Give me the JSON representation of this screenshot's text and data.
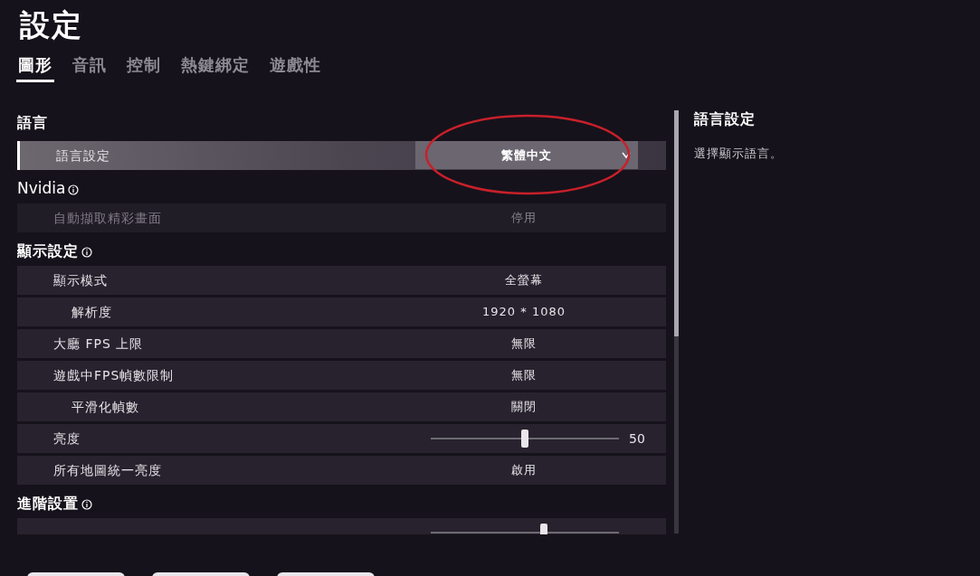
{
  "title": "設定",
  "tabs": [
    {
      "label": "圖形",
      "selected": true
    },
    {
      "label": "音訊",
      "selected": false
    },
    {
      "label": "控制",
      "selected": false
    },
    {
      "label": "熱鍵綁定",
      "selected": false
    },
    {
      "label": "遊戲性",
      "selected": false
    }
  ],
  "sections": [
    {
      "title": "語言",
      "info": false,
      "rows": [
        {
          "kind": "dropdown",
          "label": "語言設定",
          "value": "繁體中文",
          "selected": true,
          "disabled": false
        }
      ]
    },
    {
      "title": "Nvidia",
      "info": true,
      "rows": [
        {
          "kind": "value",
          "label": "自動擷取精彩畫面",
          "value": "停用",
          "selected": false,
          "disabled": true
        }
      ]
    },
    {
      "title": "顯示設定",
      "info": true,
      "rows": [
        {
          "kind": "value",
          "label": "顯示模式",
          "value": "全螢幕",
          "selected": false,
          "disabled": false,
          "children": [
            {
              "kind": "value",
              "label": "解析度",
              "value": "1920 * 1080",
              "selected": false,
              "disabled": false
            }
          ]
        },
        {
          "kind": "value",
          "label": "大廳 FPS 上限",
          "value": "無限",
          "selected": false,
          "disabled": false
        },
        {
          "kind": "value",
          "label": "遊戲中FPS幀數限制",
          "value": "無限",
          "selected": false,
          "disabled": false,
          "children": [
            {
              "kind": "value",
              "label": "平滑化幀數",
              "value": "關閉",
              "selected": false,
              "disabled": false
            }
          ]
        },
        {
          "kind": "slider",
          "label": "亮度",
          "level": 0.5,
          "reading": "50",
          "selected": false,
          "disabled": false
        },
        {
          "kind": "value",
          "label": "所有地圖統一亮度",
          "value": "啟用",
          "selected": false,
          "disabled": false
        }
      ]
    },
    {
      "title": "進階設置",
      "info": true,
      "rows": [
        {
          "kind": "slider",
          "level": 0.6,
          "selected": false
        }
      ]
    }
  ],
  "details": {
    "title": "語言設定",
    "description": "選擇顯示語言。"
  },
  "annotation": {
    "kind": "ellipse"
  }
}
